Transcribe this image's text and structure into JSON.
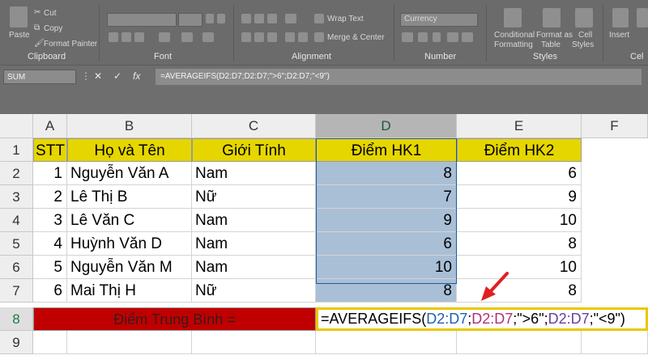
{
  "ribbon": {
    "clipboard": {
      "cut": "Cut",
      "copy": "Copy",
      "format_painter": "Format Painter",
      "paste": "Paste",
      "label": "Clipboard"
    },
    "font": {
      "label": "Font"
    },
    "alignment": {
      "wrap_text": "Wrap Text",
      "merge_center": "Merge & Center",
      "label": "Alignment"
    },
    "number": {
      "format": "Currency",
      "label": "Number"
    },
    "styles": {
      "conditional": "Conditional",
      "formatting": "Formatting",
      "format_as": "Format as",
      "table": "Table",
      "cell": "Cell",
      "styles_btn": "Styles",
      "label": "Styles"
    },
    "cells": {
      "insert": "Insert",
      "label": "Cel"
    }
  },
  "formula_bar": {
    "name_box": "SUM",
    "cancel": "✕",
    "enter": "✓",
    "fx": "fx",
    "formula": "=AVERAGEIFS(D2:D7;D2:D7;\">6\";D2:D7;\"<9\")"
  },
  "columns": [
    "A",
    "B",
    "C",
    "D",
    "E",
    "F"
  ],
  "rows": [
    "1",
    "2",
    "3",
    "4",
    "5",
    "6",
    "7",
    "8",
    "9"
  ],
  "headers": [
    "STT",
    "Họ và Tên",
    "Giới Tính",
    "Điểm HK1",
    "Điểm HK2"
  ],
  "table": [
    [
      "1",
      "Nguyễn Văn A",
      "Nam",
      "8",
      "6"
    ],
    [
      "2",
      "Lê Thị B",
      "Nữ",
      "7",
      "9"
    ],
    [
      "3",
      "Lê Văn C",
      "Nam",
      "9",
      "10"
    ],
    [
      "4",
      "Huỳnh Văn D",
      "Nam",
      "6",
      "8"
    ],
    [
      "5",
      "Nguyễn Văn M",
      "Nam",
      "10",
      "10"
    ],
    [
      "6",
      "Mai Thị H",
      "Nữ",
      "8",
      "8"
    ]
  ],
  "summary_label": "Điểm Trung Bình =",
  "formula_parts": [
    "=AVERAGEIFS(",
    "D2:D7",
    ";",
    "D2:D7",
    ";\">6\";",
    "D2:D7",
    ";\"<9\")"
  ],
  "colors": {
    "header_fill": "#e6d600",
    "summary_fill": "#c00000",
    "selection_fill": "#a9bfd6",
    "arrow": "#e02020"
  }
}
